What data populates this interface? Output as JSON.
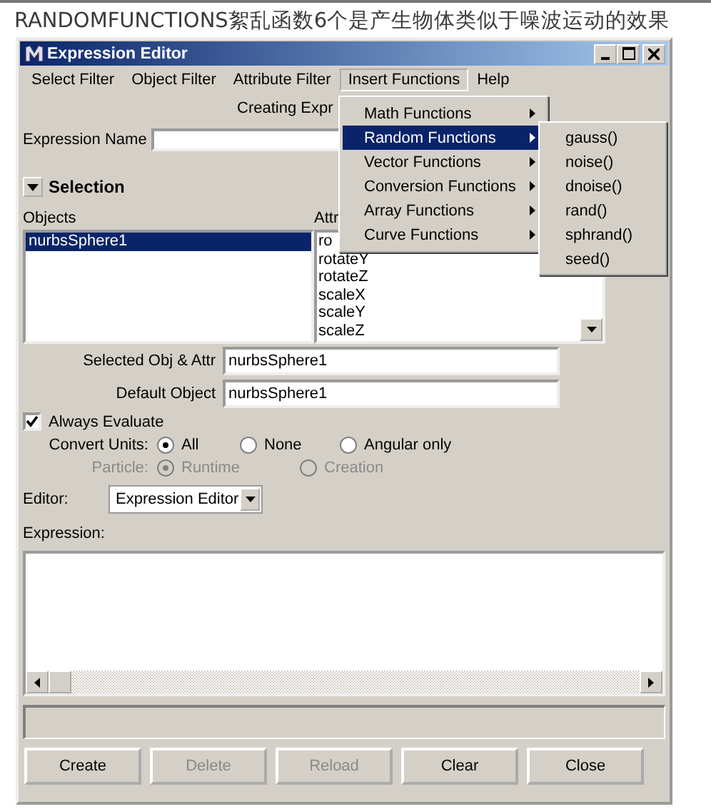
{
  "caption": "RANDOMFUNCTIONS絮乱函数6个是产生物体类似于噪波运动的效果",
  "window": {
    "title": "Expression Editor"
  },
  "menu_bar": [
    {
      "label": "Select Filter",
      "selected": false
    },
    {
      "label": "Object Filter",
      "selected": false
    },
    {
      "label": "Attribute Filter",
      "selected": false
    },
    {
      "label": "Insert Functions",
      "selected": true
    },
    {
      "label": "Help",
      "selected": false
    }
  ],
  "insert_menu": [
    {
      "label": "Math Functions",
      "selected": false
    },
    {
      "label": "Random Functions",
      "selected": true
    },
    {
      "label": "Vector Functions",
      "selected": false
    },
    {
      "label": "Conversion Functions",
      "selected": false
    },
    {
      "label": "Array Functions",
      "selected": false
    },
    {
      "label": "Curve Functions",
      "selected": false
    }
  ],
  "random_submenu": [
    "gauss()",
    "noise()",
    "dnoise()",
    "rand()",
    "sphrand()",
    "seed()"
  ],
  "creating_label": "Creating Expr",
  "expression_name_label": "Expression Name",
  "selection": {
    "title": "Selection",
    "expanded": true
  },
  "objects": {
    "label": "Objects",
    "items": [
      {
        "label": "nurbsSphere1",
        "selected": true
      }
    ]
  },
  "attributes": {
    "label": "Attr",
    "items": [
      "ro",
      "rotateY",
      "rotateZ",
      "scaleX",
      "scaleY",
      "scaleZ"
    ]
  },
  "fields": [
    {
      "label": "Selected Obj & Attr",
      "value": "nurbsSphere1"
    },
    {
      "label": "Default Object",
      "value": "nurbsSphere1"
    }
  ],
  "always_evaluate": {
    "label": "Always Evaluate",
    "checked": true
  },
  "convert_units": {
    "label": "Convert Units:",
    "disabled": false,
    "options": [
      {
        "label": "All",
        "selected": true
      },
      {
        "label": "None",
        "selected": false
      },
      {
        "label": "Angular only",
        "selected": false
      }
    ]
  },
  "particle": {
    "label": "Particle:",
    "disabled": true,
    "options": [
      {
        "label": "Runtime",
        "selected": true
      },
      {
        "label": "Creation",
        "selected": false
      }
    ]
  },
  "editor": {
    "label": "Editor:",
    "value": "Expression Editor"
  },
  "expression_label": "Expression:",
  "buttons": [
    {
      "label": "Create",
      "disabled": false
    },
    {
      "label": "Delete",
      "disabled": true
    },
    {
      "label": "Reload",
      "disabled": true
    },
    {
      "label": "Clear",
      "disabled": false
    },
    {
      "label": "Close",
      "disabled": false
    }
  ]
}
